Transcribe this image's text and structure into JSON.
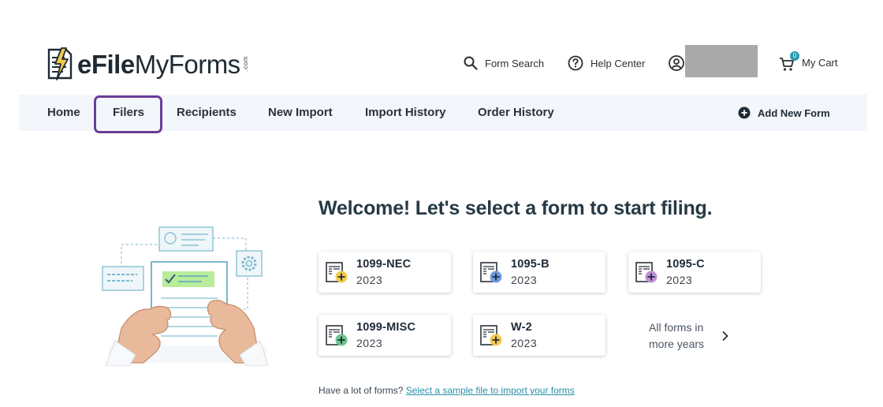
{
  "brand": {
    "logo_bold": "eFile",
    "logo_light": "MyForms",
    "logo_suffix": ".com"
  },
  "header": {
    "search_label": "Form Search",
    "help_label": "Help Center",
    "cart_label": "My Cart",
    "cart_count": "0"
  },
  "nav": {
    "items": [
      {
        "label": "Home"
      },
      {
        "label": "Filers"
      },
      {
        "label": "Recipients"
      },
      {
        "label": "New Import"
      },
      {
        "label": "Import History"
      },
      {
        "label": "Order History"
      }
    ],
    "active": "Filers",
    "add_form_label": "Add New Form"
  },
  "main": {
    "welcome": "Welcome! Let's select a form to start filing.",
    "forms": [
      {
        "name": "1099-NEC",
        "year": "2023",
        "icon": "form-plus-icon",
        "accent": "#f2c94c"
      },
      {
        "name": "1095-B",
        "year": "2023",
        "icon": "form-plus-icon",
        "accent": "#6d9de0"
      },
      {
        "name": "1095-C",
        "year": "2023",
        "icon": "form-plus-icon",
        "accent": "#c08fd8"
      },
      {
        "name": "1099-MISC",
        "year": "2023",
        "icon": "form-plus-icon",
        "accent": "#6cc48a"
      },
      {
        "name": "W-2",
        "year": "2023",
        "icon": "form-plus-icon",
        "accent": "#f2c94c"
      }
    ],
    "all_forms": "All forms in more years",
    "import_prefix": "Have a lot of forms? ",
    "import_link": "Select a sample file to import your forms"
  },
  "colors": {
    "nav_bg": "#f3f6fa",
    "active_outline": "#6a3d97",
    "link": "#2a8fa8",
    "badge": "#2a9bb3",
    "heading": "#263a45"
  }
}
